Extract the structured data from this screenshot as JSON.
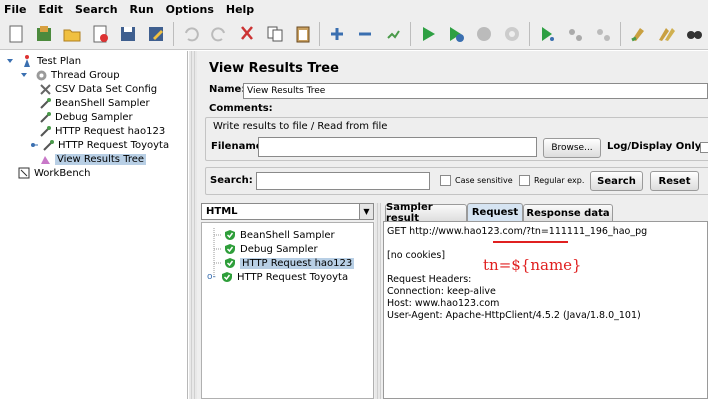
{
  "menu": [
    "File",
    "Edit",
    "Search",
    "Run",
    "Options",
    "Help"
  ],
  "toolbar": {
    "buttons": [
      "new-icon",
      "templates-icon",
      "open-icon",
      "close-icon",
      "save-icon",
      "save-as-icon",
      "cut-icon",
      "copy-icon",
      "paste-icon",
      "expand-icon",
      "collapse-icon",
      "toggle-icon",
      "start-icon",
      "start-no-timers-icon",
      "stop-icon",
      "shutdown-icon",
      "remote-start-icon",
      "remote-stop-icon",
      "remote-shutdown-icon",
      "clear-icon",
      "clear-all-icon",
      "search-icon"
    ]
  },
  "tree": {
    "test_plan": "Test Plan",
    "thread_group": "Thread Group",
    "items": [
      "CSV Data Set Config",
      "BeanShell Sampler",
      "Debug Sampler",
      "HTTP Request  hao123",
      "HTTP Request  Toyoyta",
      "View Results Tree"
    ],
    "workbench": "WorkBench"
  },
  "panel": {
    "title": "View Results Tree",
    "name_label": "Name:",
    "name_value": "View Results Tree",
    "comments_label": "Comments:",
    "write_results": "Write results to file / Read from file",
    "filename_label": "Filename",
    "filename_value": "",
    "browse": "Browse...",
    "log_display_only": "Log/Display Only:",
    "search_label": "Search:",
    "search_value": "",
    "case_sensitive": "Case sensitive",
    "regular_exp": "Regular exp.",
    "search_button": "Search",
    "reset_button": "Reset"
  },
  "results": {
    "renderer": "HTML",
    "items": [
      "BeanShell Sampler",
      "Debug Sampler",
      "HTTP Request  hao123",
      "HTTP Request  Toyoyta"
    ],
    "selected_index": 2
  },
  "tabs": [
    "Sampler result",
    "Request",
    "Response data"
  ],
  "active_tab": "Request",
  "request": {
    "line_prefix": "GET http://www.hao123.com/?",
    "line_highlight": "tn=111111",
    "line_suffix": "_196_hao_pg",
    "cookies": "[no cookies]",
    "headers_title": "Request Headers:",
    "headers": [
      "Connection: keep-alive",
      "Host: www.hao123.com",
      "User-Agent: Apache-HttpClient/4.5.2 (Java/1.8.0_101)"
    ]
  },
  "annotation": "tn=${name}",
  "colors": {
    "accent": "#e02020",
    "selection": "#b8cfe5",
    "pass_icon": "#2e9e3a"
  }
}
